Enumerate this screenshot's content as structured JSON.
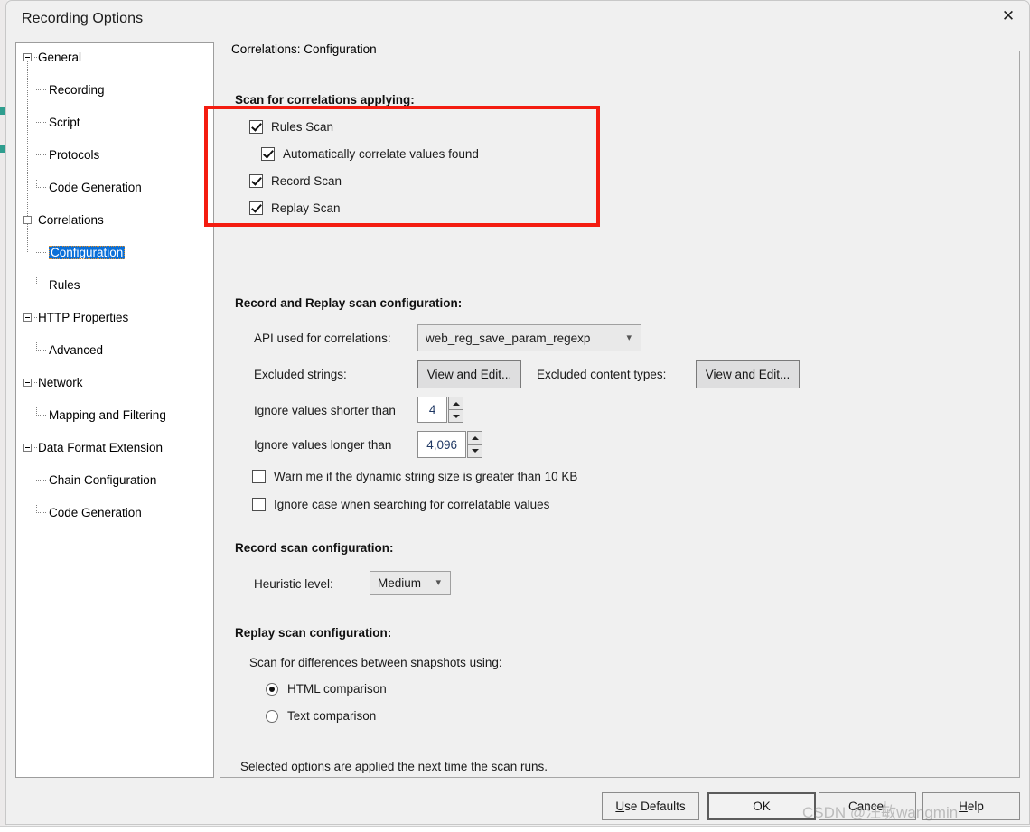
{
  "window": {
    "title": "Recording Options",
    "close_icon": "close-icon"
  },
  "tree": {
    "nodes": [
      {
        "label": "General",
        "level": 0,
        "expanded": true,
        "selected": false
      },
      {
        "label": "Recording",
        "level": 1,
        "expanded": false,
        "selected": false
      },
      {
        "label": "Script",
        "level": 1,
        "expanded": false,
        "selected": false
      },
      {
        "label": "Protocols",
        "level": 1,
        "expanded": false,
        "selected": false
      },
      {
        "label": "Code Generation",
        "level": 1,
        "expanded": false,
        "selected": false
      },
      {
        "label": "Correlations",
        "level": 0,
        "expanded": true,
        "selected": false
      },
      {
        "label": "Configuration",
        "level": 1,
        "expanded": false,
        "selected": true
      },
      {
        "label": "Rules",
        "level": 1,
        "expanded": false,
        "selected": false
      },
      {
        "label": "HTTP Properties",
        "level": 0,
        "expanded": true,
        "selected": false
      },
      {
        "label": "Advanced",
        "level": 1,
        "expanded": false,
        "selected": false
      },
      {
        "label": "Network",
        "level": 0,
        "expanded": true,
        "selected": false
      },
      {
        "label": "Mapping and Filtering",
        "level": 1,
        "expanded": false,
        "selected": false
      },
      {
        "label": "Data Format Extension",
        "level": 0,
        "expanded": true,
        "selected": false
      },
      {
        "label": "Chain Configuration",
        "level": 1,
        "expanded": false,
        "selected": false
      },
      {
        "label": "Code Generation",
        "level": 1,
        "expanded": false,
        "selected": false
      }
    ]
  },
  "panel": {
    "group_title": "Correlations: Configuration",
    "scan_section": {
      "heading": "Scan for correlations applying:",
      "items": [
        {
          "label": "Rules Scan",
          "checked": true
        },
        {
          "label": "Automatically correlate values found",
          "checked": true
        },
        {
          "label": "Record Scan",
          "checked": true
        },
        {
          "label": "Replay Scan",
          "checked": true
        }
      ]
    },
    "record_replay": {
      "heading": "Record and Replay scan configuration:",
      "api_label": "API used for correlations:",
      "api_value": "web_reg_save_param_regexp",
      "excluded_strings_label": "Excluded strings:",
      "excluded_strings_button": "View and Edit...",
      "excluded_content_label": "Excluded content types:",
      "excluded_content_button": "View and Edit...",
      "shorter_label": "Ignore values shorter than",
      "shorter_value": "4",
      "longer_label": "Ignore values longer than",
      "longer_value": "4,096",
      "warn_label": "Warn me if the dynamic string size is greater than 10 KB",
      "warn_checked": false,
      "ignore_case_label": "Ignore case when searching for correlatable values",
      "ignore_case_checked": false
    },
    "record_scan": {
      "heading": "Record scan configuration:",
      "heuristic_label": "Heuristic level:",
      "heuristic_value": "Medium"
    },
    "replay_scan": {
      "heading": "Replay scan configuration:",
      "sub_label": "Scan for differences between snapshots using:",
      "options": [
        {
          "label": "HTML comparison",
          "selected": true
        },
        {
          "label": "Text comparison",
          "selected": false
        }
      ]
    },
    "footer_note": "Selected options are applied the next time the scan runs."
  },
  "buttons": {
    "use_defaults_accel": "U",
    "use_defaults_rest": "se Defaults",
    "ok": "OK",
    "cancel": "Cancel",
    "help_accel": "H",
    "help_rest": "elp"
  },
  "annotation": {
    "highlight_color": "#f41c10"
  },
  "watermark": {
    "text": "CSDN @汪敏wangmin"
  }
}
